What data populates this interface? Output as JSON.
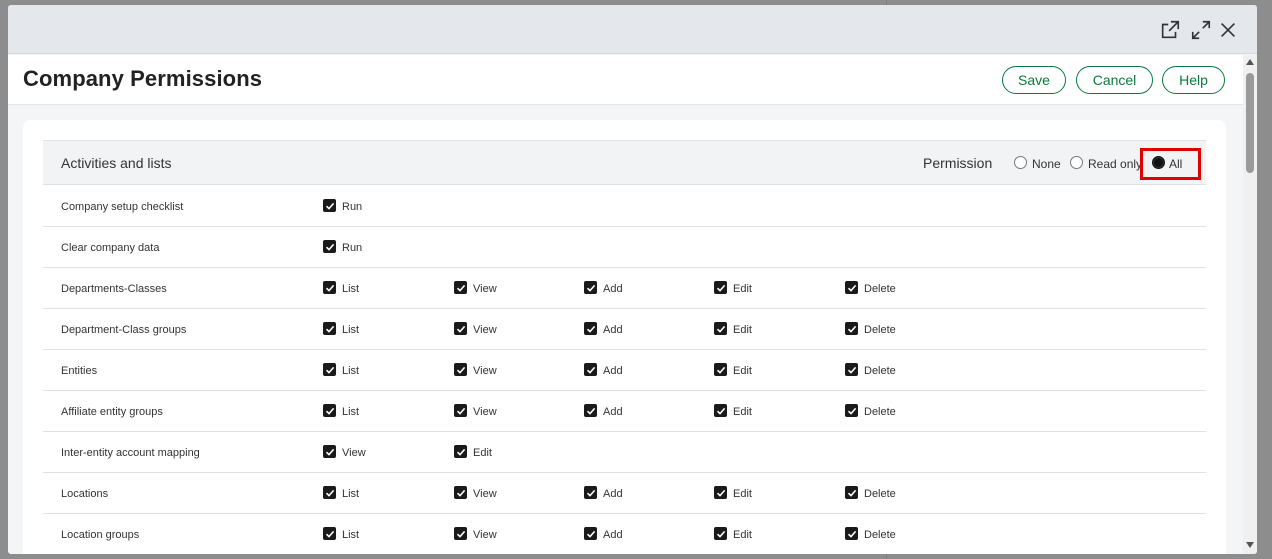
{
  "window": {
    "icons": [
      "open-in-new-window-icon",
      "expand-icon",
      "close-icon"
    ]
  },
  "header": {
    "title": "Company Permissions",
    "save_label": "Save",
    "cancel_label": "Cancel",
    "help_label": "Help"
  },
  "section": {
    "title": "Activities and lists",
    "permission_label": "Permission",
    "options": [
      {
        "label": "None",
        "checked": false
      },
      {
        "label": "Read only",
        "checked": false
      },
      {
        "label": "All",
        "checked": true
      }
    ]
  },
  "rows": [
    {
      "label": "Company setup checklist",
      "perms": [
        "Run"
      ]
    },
    {
      "label": "Clear company data",
      "perms": [
        "Run"
      ]
    },
    {
      "label": "Departments-Classes",
      "perms": [
        "List",
        "View",
        "Add",
        "Edit",
        "Delete"
      ]
    },
    {
      "label": "Department-Class groups",
      "perms": [
        "List",
        "View",
        "Add",
        "Edit",
        "Delete"
      ]
    },
    {
      "label": "Entities",
      "perms": [
        "List",
        "View",
        "Add",
        "Edit",
        "Delete"
      ]
    },
    {
      "label": "Affiliate entity groups",
      "perms": [
        "List",
        "View",
        "Add",
        "Edit",
        "Delete"
      ]
    },
    {
      "label": "Inter-entity account mapping",
      "perms": [
        "View",
        "Edit"
      ]
    },
    {
      "label": "Locations",
      "perms": [
        "List",
        "View",
        "Add",
        "Edit",
        "Delete"
      ]
    },
    {
      "label": "Location groups",
      "perms": [
        "List",
        "View",
        "Add",
        "Edit",
        "Delete"
      ]
    }
  ],
  "colors": {
    "accent": "#0a7a3e",
    "highlight": "#e00000"
  }
}
